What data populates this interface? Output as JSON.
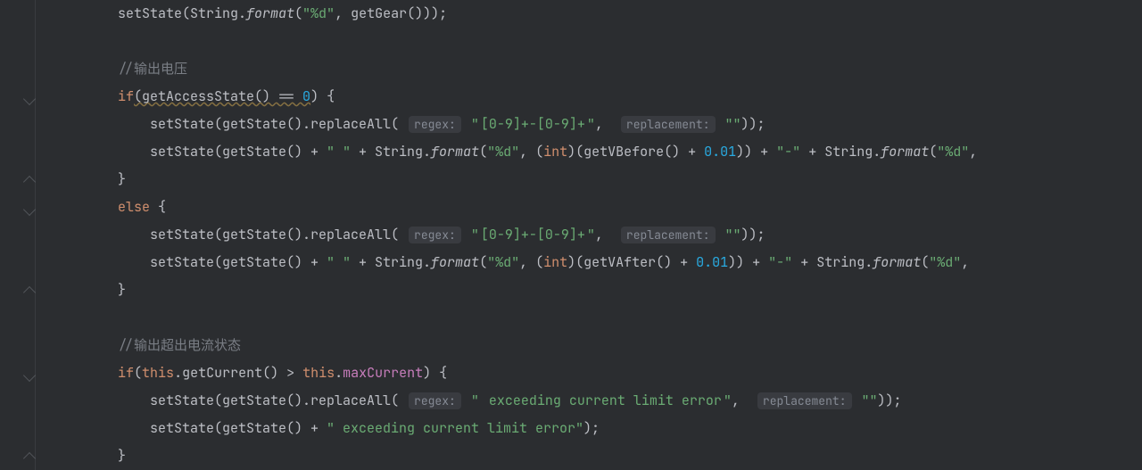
{
  "hints": {
    "regex": "regex:",
    "replacement": "replacement:"
  },
  "code": {
    "l1": {
      "pre": "        setState(String.",
      "fmt": "format",
      "paren": "(",
      "s1": "\"%d\"",
      "after": ", getGear()));"
    },
    "l3": {
      "comment": "//输出电压"
    },
    "l4": {
      "kw": "if",
      "cond": "(getAccessState() == ",
      "zero": "0",
      "tail": ") {"
    },
    "l5": {
      "pre": "            setState(getState().replaceAll( ",
      "s1": "\"",
      "s1hl": "[0-9]+-[0-9]+",
      "s1end": "\"",
      "comma": ",  ",
      "s2": "\"\"",
      "tail": "));"
    },
    "l6": {
      "pre": "            setState(getState() + ",
      "sp": "\" \"",
      "plus1": " + String.",
      "fmt": "format",
      "p1": "(",
      "s1": "\"%d\"",
      "mid": ", (",
      "cast": "int",
      "mid2": ")(getVBefore() + ",
      "num": "0.01",
      "mid3": ")) + ",
      "dash": "\"-\"",
      "plus2": " + String.",
      "fmt2": "format",
      "p2": "(",
      "s2": "\"%d\"",
      "tail": ","
    },
    "l7": {
      "brace": "        }"
    },
    "l8": {
      "kw": "else",
      "tail": " {"
    },
    "l9": {
      "pre": "            setState(getState().replaceAll( ",
      "s1": "\"",
      "s1hl": "[0-9]+-[0-9]+",
      "s1end": "\"",
      "comma": ",  ",
      "s2": "\"\"",
      "tail": "));"
    },
    "l10": {
      "pre": "            setState(getState() + ",
      "sp": "\" \"",
      "plus1": " + String.",
      "fmt": "format",
      "p1": "(",
      "s1": "\"%d\"",
      "mid": ", (",
      "cast": "int",
      "mid2": ")(getVAfter() + ",
      "num": "0.01",
      "mid3": ")) + ",
      "dash": "\"-\"",
      "plus2": " + String.",
      "fmt2": "format",
      "p2": "(",
      "s2": "\"%d\"",
      "tail": ","
    },
    "l11": {
      "brace": "        }"
    },
    "l13": {
      "comment": "//输出超出电流状态"
    },
    "l14": {
      "kw": "if",
      "p1": "(",
      "this1": "this",
      "dot1": ".getCurrent() > ",
      "this2": "this",
      "dot2": ".",
      "field": "maxCurrent",
      "tail": ") {"
    },
    "l15": {
      "pre": "            setState(getState().replaceAll( ",
      "s1": "\"",
      "s1hl": " exceeding current limit error",
      "s1end": "\"",
      "comma": ",  ",
      "s2": "\"\"",
      "tail": "));"
    },
    "l16": {
      "pre": "            setState(getState() + ",
      "str": "\" exceeding current limit error\"",
      "tail": ");"
    },
    "l17": {
      "brace": "        }"
    }
  }
}
